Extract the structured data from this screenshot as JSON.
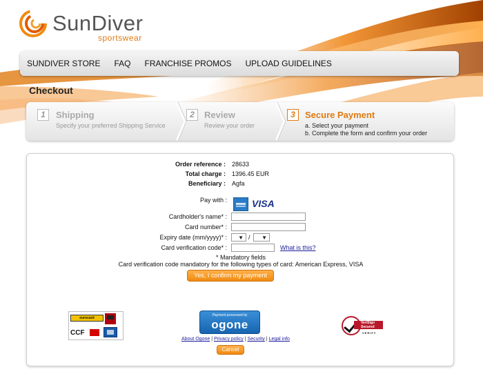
{
  "brand": {
    "name": "SunDiver",
    "tagline": "sportswear"
  },
  "nav": {
    "items": [
      "SUNDIVER STORE",
      "FAQ",
      "FRANCHISE PROMOS",
      "UPLOAD GUIDELINES"
    ]
  },
  "page_title": "Checkout",
  "steps": [
    {
      "number": "1",
      "title": "Shipping",
      "desc": "Specify your preferred Shipping Service",
      "desc2": "",
      "active": false
    },
    {
      "number": "2",
      "title": "Review",
      "desc": "Review your order",
      "desc2": "",
      "active": false
    },
    {
      "number": "3",
      "title": "Secure Payment",
      "desc": "a. Select your payment",
      "desc2": "b. Complete the form and confirm your order",
      "active": true
    }
  ],
  "order": {
    "reference_label": "Order reference :",
    "reference_value": "28633",
    "charge_label": "Total charge :",
    "charge_value": "1396.45 EUR",
    "beneficiary_label": "Beneficiary :",
    "beneficiary_value": "Agfa"
  },
  "payment": {
    "pay_with_label": "Pay with :",
    "cards": [
      "amex-icon",
      "visa-icon"
    ],
    "visa_text": "VISA",
    "cardholder_label": "Cardholder's name* :",
    "cardholder_value": "",
    "card_number_label": "Card number* :",
    "card_number_value": "",
    "expiry_label": "Expiry date (mm/yyyy)* :",
    "expiry_month": "",
    "expiry_separator": "/",
    "expiry_year": "",
    "cvc_label": "Card verification code* :",
    "cvc_value": "",
    "cvc_help_link": "What is this?",
    "mandatory_note": "* Mandatory fields",
    "cvc_note": "Card verification code mandatory for the following types of card: American Express, VISA",
    "confirm_button": "Yes, I confirm my payment"
  },
  "footer": {
    "ccf_text": "CCF",
    "euro_text": "eurocard",
    "ogone_small": "Payment processed by",
    "ogone_big": "ogone",
    "links": [
      "About Ogone",
      "Privacy policy",
      "Security",
      "Legal info"
    ],
    "separator": "|",
    "cancel_button": "Cancel",
    "verisign_text": "VeriSign Secured",
    "verisign_verify": "VERIFY"
  },
  "colors": {
    "accent": "#e07a10",
    "button": "#f08a10",
    "link": "#1a1a9a"
  }
}
